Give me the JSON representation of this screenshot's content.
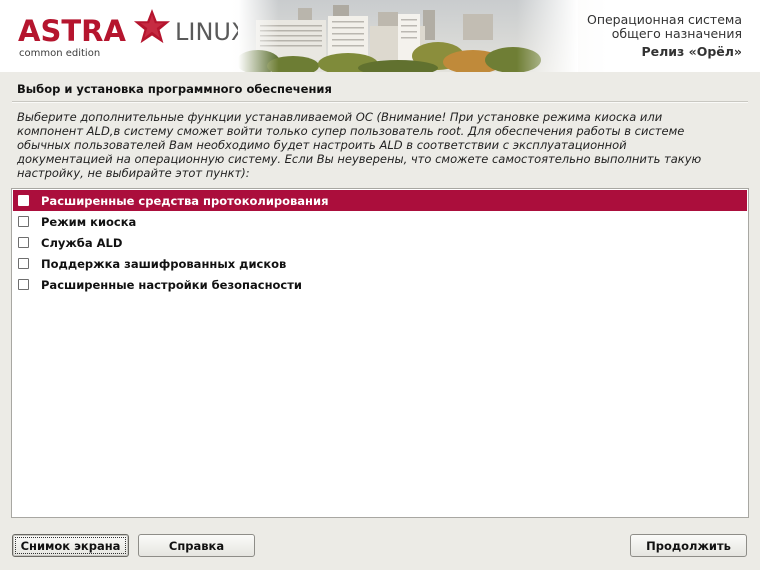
{
  "header": {
    "logo_brand": "ASTRA",
    "logo_product": "LINUX",
    "logo_edition": "common edition",
    "os_title_line1": "Операционная система",
    "os_title_line2": "общего назначения",
    "os_release": "Релиз «Орёл»",
    "brand_color": "#b5152e"
  },
  "section": {
    "title": "Выбор и установка программного обеспечения",
    "description": "Выберите дополнительные функции устанавливаемой ОС (Внимание! При установке режима киоска или\nкомпонент ALD,в систему сможет войти только супер пользователь root. Для обеспечения работы в системе\nобычных пользователей Вам необходимо будет настроить ALD в соответствии с эксплуатационной\nдокументацией на операционную систему. Если Вы неуверены, что сможете самостоятельно выполнить такую\nнастройку, не выбирайте этот пункт):"
  },
  "options": [
    {
      "label": "Расширенные средства протоколирования",
      "checked": false,
      "selected": true
    },
    {
      "label": "Режим киоска",
      "checked": false,
      "selected": false
    },
    {
      "label": "Служба ALD",
      "checked": false,
      "selected": false
    },
    {
      "label": "Поддержка зашифрованных дисков",
      "checked": false,
      "selected": false
    },
    {
      "label": "Расширенные настройки безопасности",
      "checked": false,
      "selected": false
    }
  ],
  "selection_color": "#ab0e3c",
  "buttons": {
    "screenshot": "Снимок экрана",
    "help": "Справка",
    "continue": "Продолжить"
  }
}
